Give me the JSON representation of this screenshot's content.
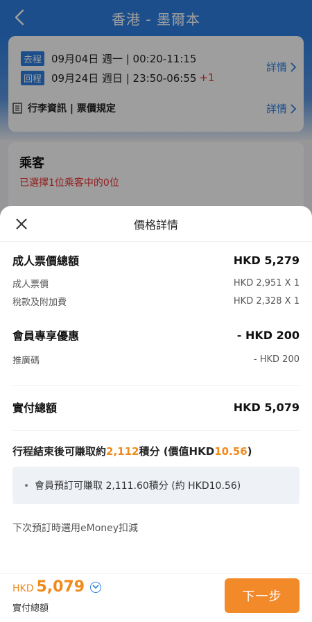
{
  "header": {
    "title": "香港 - 墨爾本"
  },
  "flight": {
    "outbound": {
      "tag": "去程",
      "info": "09月04日 週一 | 00:20-11:15"
    },
    "return": {
      "tag": "回程",
      "info": "09月24日 週日 | 23:50-06:55",
      "plus": "+1"
    },
    "detail_label": "詳情",
    "baggage_label": "行李資訊 | 票價規定"
  },
  "passenger": {
    "title": "乘客",
    "subtitle": "已選擇1位乘客中的0位"
  },
  "sheet": {
    "title": "價格詳情",
    "adult_total": {
      "label": "成人票價總額",
      "value": "HKD 5,279"
    },
    "adult_fare": {
      "label": "成人票價",
      "value": "HKD 2,951 X 1"
    },
    "taxes": {
      "label": "稅款及附加費",
      "value": "HKD 2,328 X 1"
    },
    "member_discount": {
      "label": "會員專享優惠",
      "value": "- HKD 200"
    },
    "promo": {
      "label": "推廣碼",
      "value": "- HKD 200"
    },
    "payable": {
      "label": "實付總額",
      "value": "HKD 5,079"
    },
    "points": {
      "prefix": "行程結束後可賺取約",
      "points_value": "2,112",
      "middle": "積分 (價值HKD",
      "worth_value": "10.56",
      "suffix": ")"
    },
    "points_detail": "會員預訂可賺取 2,111.60積分 (約 HKD10.56)",
    "emoney_note": "下次預訂時選用eMoney扣減"
  },
  "footer": {
    "currency": "HKD",
    "amount": "5,079",
    "total_label": "實付總額",
    "next_label": "下一步"
  },
  "colors": {
    "brand_blue": "#2c7fe0",
    "accent_orange": "#f08a1c",
    "alert_red": "#e33333"
  }
}
